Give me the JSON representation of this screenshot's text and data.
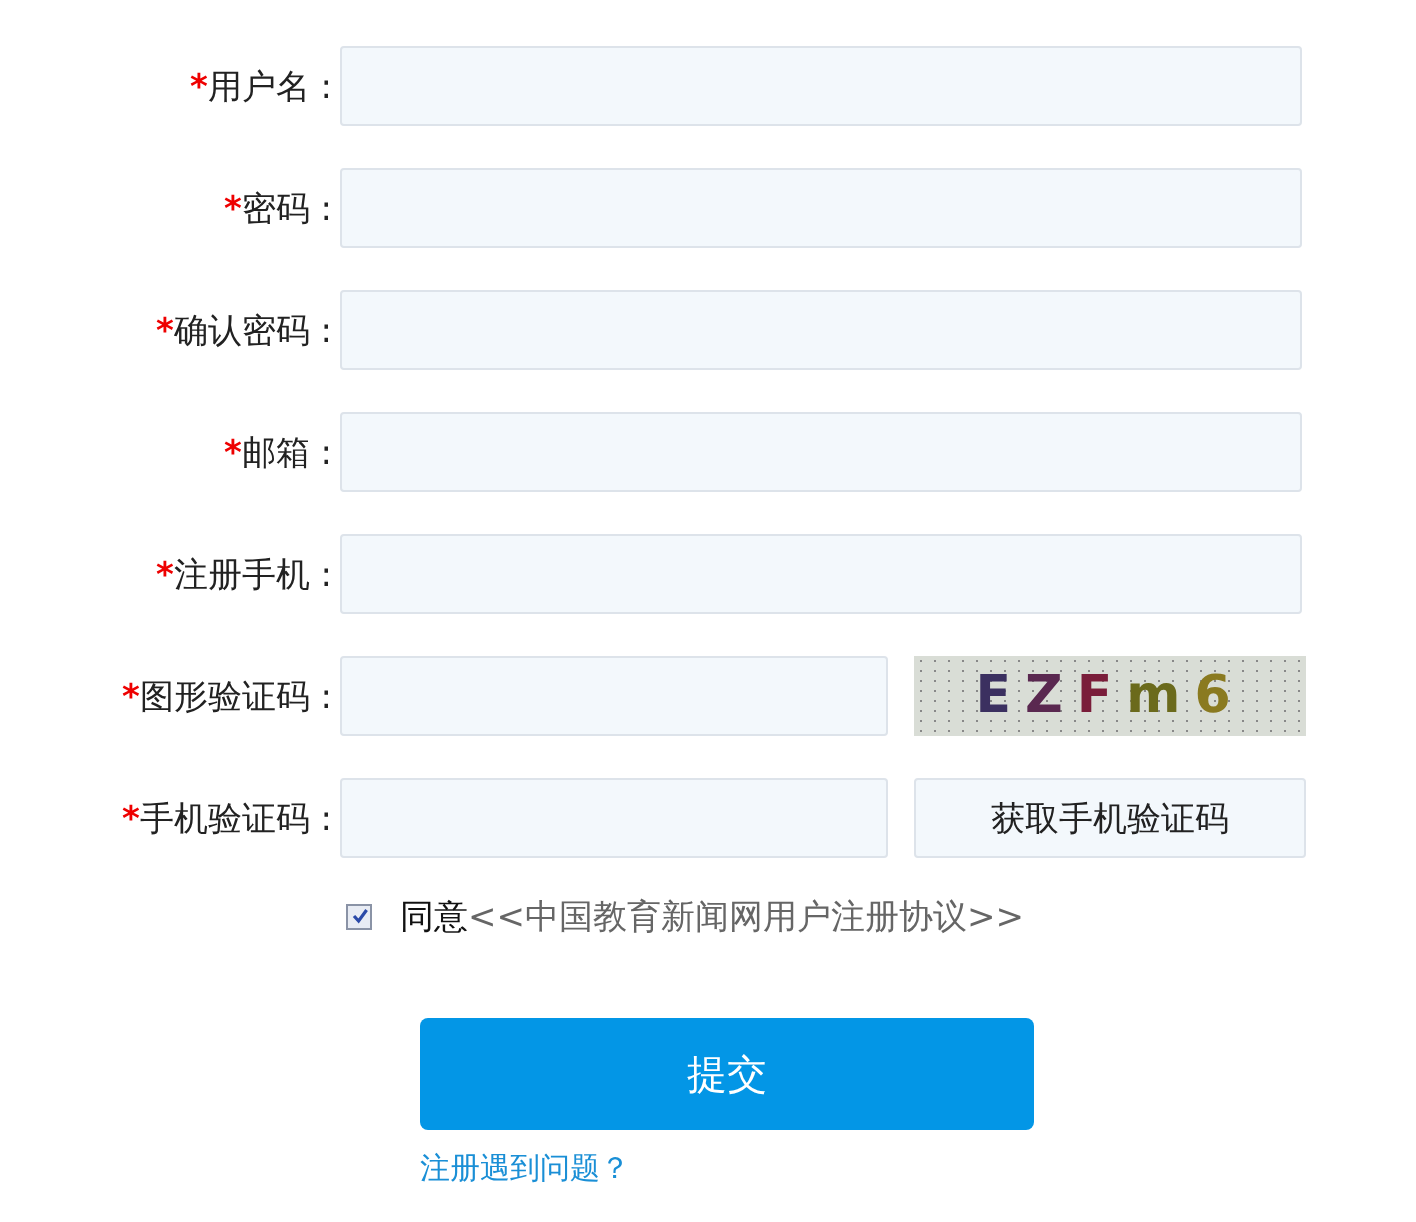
{
  "fields": [
    {
      "marker": "*",
      "label": "用户名 :",
      "kind": "text"
    },
    {
      "marker": "*",
      "label": "密码 :",
      "kind": "text"
    },
    {
      "marker": "*",
      "label": "确认密码 :",
      "kind": "text"
    },
    {
      "marker": "*",
      "label": "邮箱 :",
      "kind": "text"
    },
    {
      "marker": "*",
      "label": "注册手机 :",
      "kind": "text"
    },
    {
      "marker": "*",
      "label": "图形验证码 :",
      "kind": "captcha",
      "captcha": "EZFm6"
    },
    {
      "marker": "*",
      "label": "手机验证码 :",
      "kind": "sms",
      "button": "获取手机验证码"
    }
  ],
  "agreement": {
    "checked": true,
    "prefix": "同意",
    "link": "<<中国教育新闻网用户注册协议>>"
  },
  "submit": "提交",
  "help_link": "注册遇到问题？"
}
